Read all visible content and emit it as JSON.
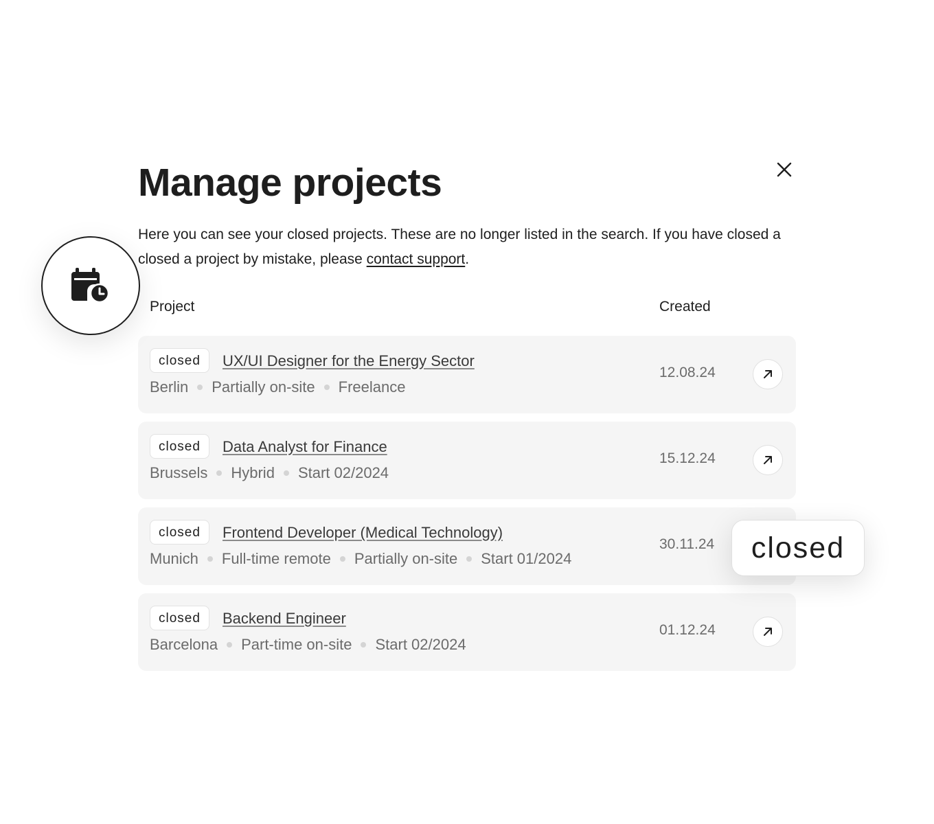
{
  "dialog": {
    "title": "Manage projects",
    "intro_text": "Here you can see your closed projects. These are no longer listed in the search. If you have closed a closed a project by mistake, please ",
    "support_link": "contact support",
    "intro_end": "."
  },
  "table": {
    "col_project": "Project",
    "col_created": "Created"
  },
  "projects": [
    {
      "status": "closed",
      "title": "UX/UI Designer for the Energy Sector",
      "meta": [
        "Berlin",
        "Partially on-site",
        "Freelance"
      ],
      "created": "12.08.24"
    },
    {
      "status": "closed",
      "title": "Data Analyst for Finance",
      "meta": [
        "Brussels",
        "Hybrid",
        "Start 02/2024"
      ],
      "created": "15.12.24"
    },
    {
      "status": "closed",
      "title": "Frontend Developer (Medical Technology)",
      "meta": [
        "Munich",
        "Full-time remote",
        "Partially on-site",
        "Start 01/2024"
      ],
      "created": "30.11.24"
    },
    {
      "status": "closed",
      "title": "Backend Engineer",
      "meta": [
        "Barcelona",
        "Part-time on-site",
        "Start 02/2024"
      ],
      "created": "01.12.24"
    }
  ],
  "floating_tag": {
    "label": "closed"
  },
  "icons": {
    "close": "close-icon",
    "open": "arrow-up-right-icon",
    "calendar": "calendar-clock-icon"
  },
  "colors": {
    "text": "#1e1e1e",
    "muted": "#6b6b6b",
    "row_bg": "#f5f5f5"
  }
}
